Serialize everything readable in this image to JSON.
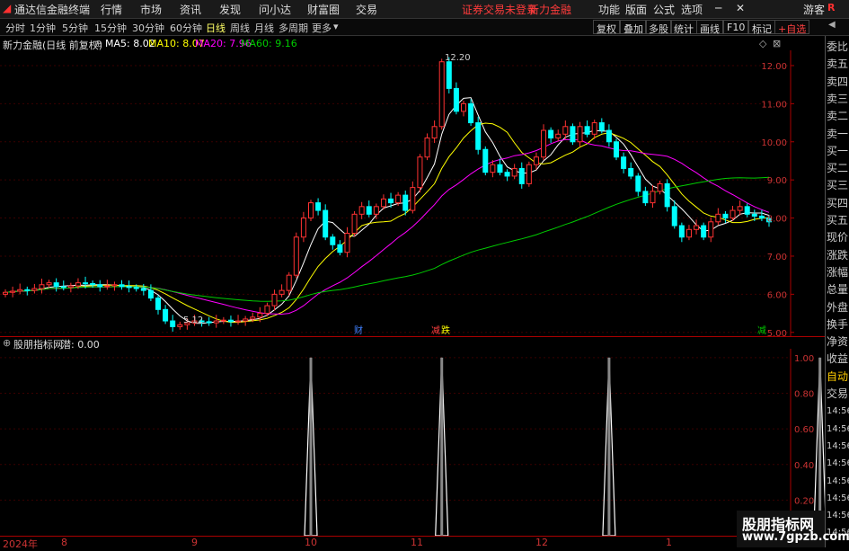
{
  "menubar": {
    "app_name": "通达信金融终端",
    "items": [
      "行情",
      "市场",
      "资讯",
      "发现",
      "问小达",
      "财富圈",
      "交易"
    ],
    "notice": "证券交易未登录",
    "brand": "新力金融",
    "right_items": [
      "功能",
      "版面",
      "公式",
      "选项"
    ],
    "guest": "游客"
  },
  "periodbar": {
    "periods": [
      "分时",
      "1分钟",
      "5分钟",
      "15分钟",
      "30分钟",
      "60分钟",
      "日线",
      "周线",
      "月线",
      "多周期",
      "更多"
    ],
    "active": "日线",
    "tools": [
      "复权",
      "叠加",
      "多股",
      "统计",
      "画线",
      "F10",
      "标记",
      "+自选"
    ]
  },
  "info": {
    "stock_title": "新力金融(日线 前复权)",
    "ma5": "MA5: 8.02",
    "ma10": "MA10: 8.07",
    "ma20": "MA20: 7.96",
    "ma60": "MA60: 9.16",
    "high_label": "12.20",
    "low_label": "5.12"
  },
  "markers": {
    "m1": "财",
    "m2": "减",
    "m3": "跌",
    "m4": "减"
  },
  "indicator": {
    "title": "股朋指标网",
    "value": "潜: 0.00"
  },
  "right_panel": {
    "labels": [
      "委比",
      "卖五",
      "卖四",
      "卖三",
      "卖二",
      "卖一",
      "买一",
      "买二",
      "买三",
      "买四",
      "买五",
      "现价",
      "涨跌",
      "涨幅",
      "总量",
      "外盘",
      "换手",
      "净资",
      "收益",
      "自动",
      "交易",
      "14:56",
      "14:56",
      "14:56",
      "14:56",
      "14:56",
      "14:56",
      "14:56",
      "14:56"
    ]
  },
  "watermark": {
    "line1": "股朋指标网",
    "line2": "www.7gpzb.com"
  },
  "chart_data": [
    {
      "type": "candlestick",
      "title": "新力金融(日线 前复权)",
      "ylim": [
        4.9,
        12.4
      ],
      "yticks": [
        5.0,
        6.0,
        7.0,
        8.0,
        9.0,
        10.0,
        11.0,
        12.0
      ],
      "xticks": [
        "2024年",
        "8",
        "9",
        "10",
        "11",
        "12",
        "1"
      ],
      "high": 12.2,
      "low": 5.12,
      "closes": [
        6.05,
        6.08,
        6.12,
        6.1,
        6.15,
        6.25,
        6.3,
        6.2,
        6.18,
        6.22,
        6.3,
        6.28,
        6.25,
        6.2,
        6.22,
        6.25,
        6.2,
        6.18,
        6.15,
        6.1,
        5.9,
        5.6,
        5.3,
        5.15,
        5.2,
        5.25,
        5.3,
        5.28,
        5.25,
        5.3,
        5.32,
        5.28,
        5.3,
        5.35,
        5.4,
        5.5,
        5.7,
        6.0,
        6.1,
        6.5,
        7.5,
        8.0,
        8.4,
        8.2,
        7.5,
        7.3,
        7.1,
        7.6,
        8.1,
        8.3,
        8.1,
        8.3,
        8.5,
        8.4,
        8.6,
        8.2,
        8.8,
        9.6,
        10.1,
        10.4,
        12.1,
        11.4,
        10.8,
        11.0,
        10.5,
        9.8,
        9.2,
        9.4,
        9.2,
        9.1,
        9.3,
        8.9,
        9.4,
        9.6,
        10.3,
        10.1,
        10.2,
        10.4,
        10.0,
        10.4,
        10.2,
        10.5,
        10.3,
        10.0,
        9.6,
        9.3,
        9.1,
        8.7,
        8.4,
        8.7,
        8.9,
        8.3,
        7.8,
        7.5,
        7.7,
        7.8,
        7.5,
        7.9,
        8.1,
        8.0,
        8.2,
        8.3,
        8.1,
        8.05,
        8.0,
        7.9
      ],
      "series": [
        {
          "name": "MA5",
          "color": "#ffffff"
        },
        {
          "name": "MA10",
          "color": "#ffff00"
        },
        {
          "name": "MA20",
          "color": "#ff00ff"
        },
        {
          "name": "MA60",
          "color": "#00cc00"
        }
      ]
    },
    {
      "type": "line",
      "title": "股朋指标网",
      "ylim": [
        0,
        1.05
      ],
      "yticks": [
        0.2,
        0.4,
        0.6,
        0.8,
        1.0
      ],
      "spikes_at_index": [
        42,
        60,
        83,
        112
      ],
      "spike_value": 1.0
    }
  ]
}
